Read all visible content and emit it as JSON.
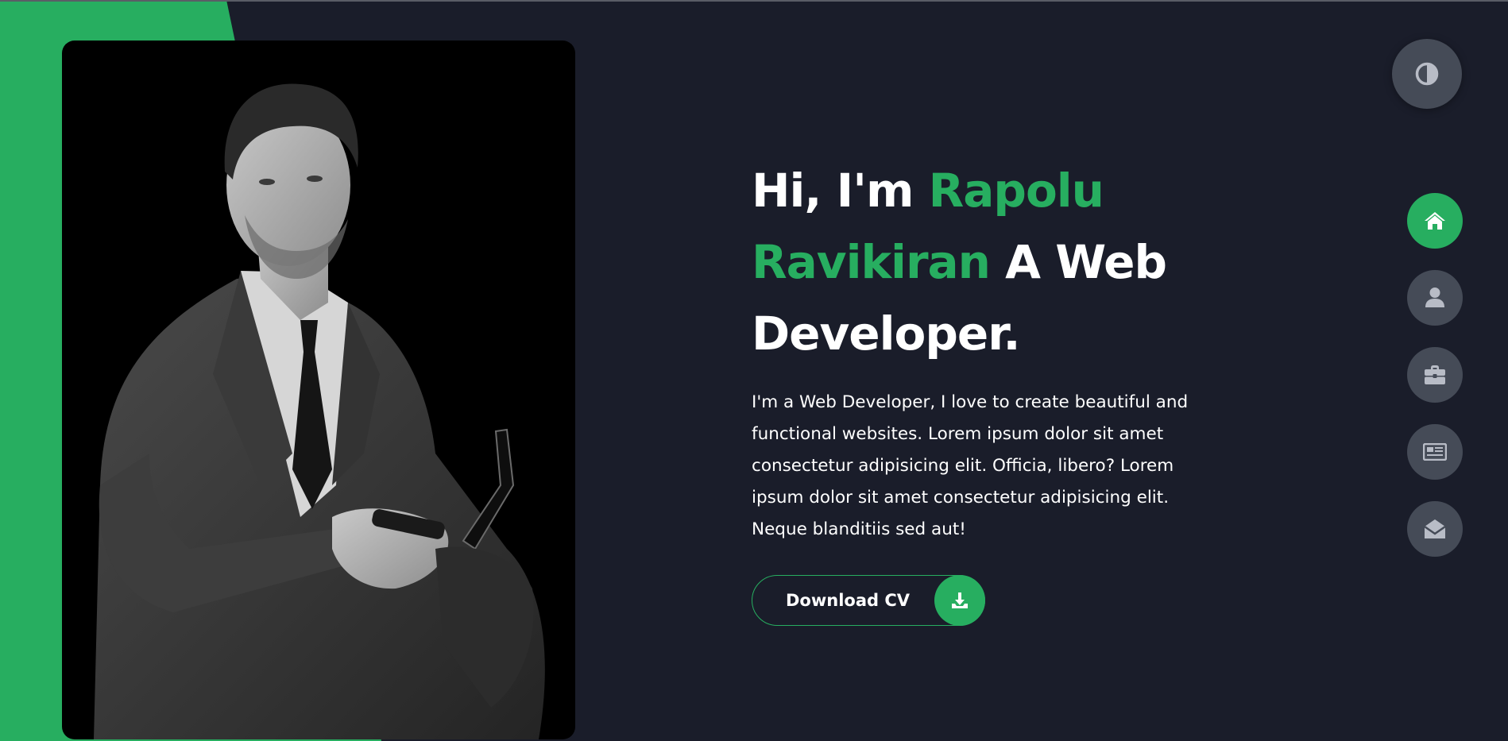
{
  "hero": {
    "greeting": "Hi, I'm ",
    "name": "Rapolu Ravikiran",
    "role": " A Web Developer.",
    "intro": "I'm a Web Developer, I love to create beautiful and functional websites. Lorem ipsum dolor sit amet consectetur adipisicing elit. Officia, libero? Lorem ipsum dolor sit amet consectetur adipisicing elit. Neque blanditiis sed aut!",
    "download_label": "Download CV"
  },
  "nav": {
    "active": "home",
    "items": [
      {
        "id": "home",
        "icon": "home-icon"
      },
      {
        "id": "about",
        "icon": "user-icon"
      },
      {
        "id": "portfolio",
        "icon": "briefcase-icon"
      },
      {
        "id": "blogs",
        "icon": "newspaper-icon"
      },
      {
        "id": "contact",
        "icon": "envelope-open-icon"
      }
    ]
  },
  "theme_toggle": {
    "icon": "adjust-icon"
  },
  "colors": {
    "accent": "#27ae60",
    "background": "#1a1d2a",
    "control_gray": "#454b57",
    "icon_gray": "#b8bcc6"
  }
}
